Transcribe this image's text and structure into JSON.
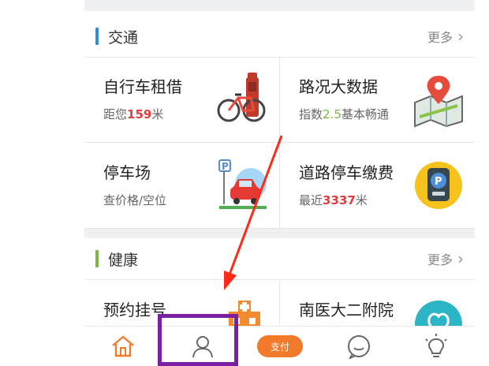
{
  "sections": [
    {
      "title": "交通",
      "more": "更多",
      "accent": "#2f8de0",
      "items": [
        {
          "name": "自行车租借",
          "sub_prefix": "距您",
          "sub_value": "159",
          "sub_suffix": "米",
          "icon": "bike-rental-icon"
        },
        {
          "name": "路况大数据",
          "sub_prefix": "指数",
          "sub_value": "2.5",
          "sub_suffix": "基本畅通",
          "icon": "map-pin-icon"
        },
        {
          "name": "停车场",
          "sub_prefix": "查价格/空位",
          "sub_value": "",
          "sub_suffix": "",
          "icon": "parking-lot-icon"
        },
        {
          "name": "道路停车缴费",
          "sub_prefix": "最近",
          "sub_value": "3337",
          "sub_suffix": "米",
          "icon": "parking-meter-icon"
        }
      ]
    },
    {
      "title": "健康",
      "more": "更多",
      "accent": "#7cb342",
      "items": [
        {
          "name": "预约挂号",
          "icon": "hospital-icon"
        },
        {
          "name": "南医大二附院",
          "icon": "hospital-logo-icon"
        }
      ]
    }
  ],
  "tabbar": {
    "items": [
      {
        "icon": "home-icon"
      },
      {
        "icon": "user-icon"
      },
      {
        "label": "支付",
        "icon": "pay-cloud-icon",
        "color": "#f47a2b"
      },
      {
        "icon": "chat-icon"
      },
      {
        "icon": "lightbulb-icon"
      }
    ]
  },
  "annotation": {
    "box_color": "#7b1fa2",
    "arrow_color": "#ff2a1a"
  }
}
